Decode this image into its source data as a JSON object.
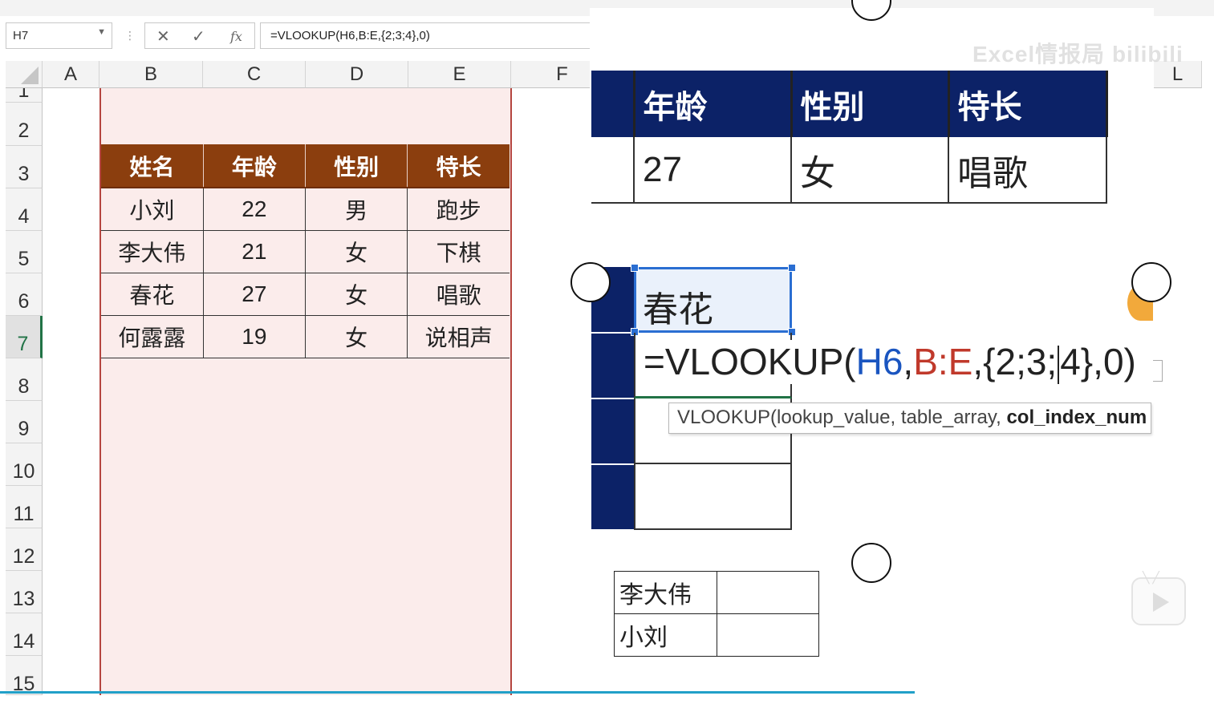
{
  "name_box": {
    "value": "H7"
  },
  "formula_bar": {
    "formula": "=VLOOKUP(H6,B:E,{2;3;4},0)"
  },
  "columns": [
    "A",
    "B",
    "C",
    "D",
    "E",
    "F"
  ],
  "right_column": "L",
  "rows": [
    "1",
    "2",
    "3",
    "4",
    "5",
    "6",
    "7",
    "8",
    "9",
    "10",
    "11",
    "12",
    "13",
    "14",
    "15"
  ],
  "active_row": "7",
  "main_table": {
    "headers": [
      "姓名",
      "年龄",
      "性别",
      "特长"
    ],
    "rows": [
      [
        "小刘",
        "22",
        "男",
        "跑步"
      ],
      [
        "李大伟",
        "21",
        "女",
        "下棋"
      ],
      [
        "春花",
        "27",
        "女",
        "唱歌"
      ],
      [
        "何露露",
        "19",
        "女",
        "说相声"
      ]
    ]
  },
  "zoom_table": {
    "headers": [
      "年龄",
      "性别",
      "特长"
    ],
    "row": [
      "27",
      "女",
      "唱歌"
    ]
  },
  "zoom_lookup": {
    "cell_value": "春花",
    "formula_prefix": "=VLOOKUP(",
    "ref1": "H6",
    "comma1": ",",
    "ref2": "B:E",
    "formula_mid": ",{2;3;",
    "formula_end": "4},0)"
  },
  "tooltip": {
    "prefix": "VLOOKUP(lookup_value, table_array, ",
    "bold": "col_index_num"
  },
  "small_table": {
    "rows": [
      [
        "李大伟",
        ""
      ],
      [
        "小刘",
        ""
      ]
    ]
  },
  "watermark": "Excel情报局 bilibili",
  "colors": {
    "header_brown": "#8b3e0e",
    "navy": "#0c2267",
    "selection_blue": "#2a6ed2",
    "excel_green": "#217346",
    "pink_fill": "#fbeceb"
  }
}
